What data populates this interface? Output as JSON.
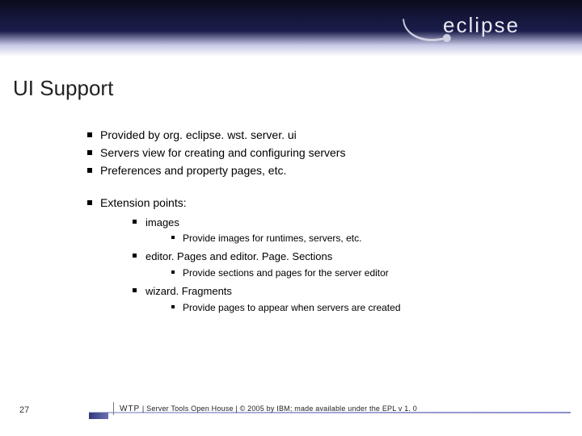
{
  "logo": {
    "wordmark": "eclipse"
  },
  "title": "UI Support",
  "bullets": {
    "b0": "Provided by org. eclipse. wst. server. ui",
    "b1": "Servers view for creating and configuring servers",
    "b2": "Preferences and property pages, etc.",
    "b3": "Extension points:",
    "ext": {
      "e0": {
        "name": "images",
        "desc": "Provide images for runtimes, servers, etc."
      },
      "e1": {
        "name": "editor. Pages and editor. Page. Sections",
        "desc": "Provide sections and pages for the server editor"
      },
      "e2": {
        "name": "wizard. Fragments",
        "desc": "Provide pages to appear when servers are created"
      }
    }
  },
  "footer": {
    "page": "27",
    "wtp": "WTP",
    "rest": "  |  Server Tools Open House  |  © 2005 by IBM; made available under the EPL v 1. 0"
  }
}
